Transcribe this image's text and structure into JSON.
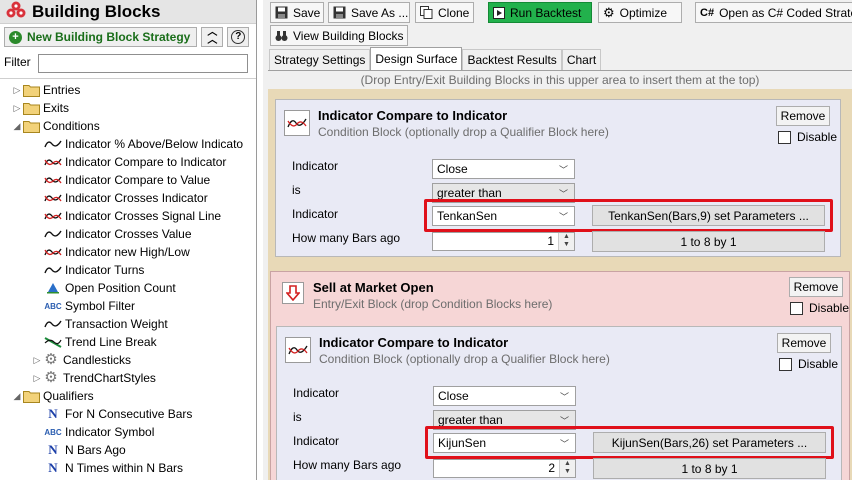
{
  "left_panel": {
    "title": "Building Blocks",
    "new_button_label": "New Building Block Strategy",
    "filter_label": "Filter",
    "filter_value": "",
    "tree": [
      {
        "label": "Entries",
        "level": 0,
        "kind": "folder",
        "expanded": false
      },
      {
        "label": "Exits",
        "level": 0,
        "kind": "folder",
        "expanded": false
      },
      {
        "label": "Conditions",
        "level": 0,
        "kind": "folder",
        "expanded": true
      },
      {
        "label": "Indicator % Above/Below Indicato",
        "level": 1,
        "kind": "wave-black"
      },
      {
        "label": "Indicator Compare to Indicator",
        "level": 1,
        "kind": "wave-red"
      },
      {
        "label": "Indicator Compare to Value",
        "level": 1,
        "kind": "wave-red"
      },
      {
        "label": "Indicator Crosses Indicator",
        "level": 1,
        "kind": "wave-red"
      },
      {
        "label": "Indicator Crosses Signal Line",
        "level": 1,
        "kind": "wave-red"
      },
      {
        "label": "Indicator Crosses Value",
        "level": 1,
        "kind": "wave-black"
      },
      {
        "label": "Indicator new High/Low",
        "level": 1,
        "kind": "wave-red"
      },
      {
        "label": "Indicator Turns",
        "level": 1,
        "kind": "wave-black"
      },
      {
        "label": "Open Position Count",
        "level": 1,
        "kind": "arrow-blue"
      },
      {
        "label": "Symbol Filter",
        "level": 1,
        "kind": "abc"
      },
      {
        "label": "Transaction Weight",
        "level": 1,
        "kind": "wave-black"
      },
      {
        "label": "Trend Line Break",
        "level": 1,
        "kind": "trend-green"
      },
      {
        "label": "Candlesticks",
        "level": 1,
        "kind": "gear",
        "expandable": true
      },
      {
        "label": "TrendChartStyles",
        "level": 1,
        "kind": "gear",
        "expandable": true
      },
      {
        "label": "Qualifiers",
        "level": 0,
        "kind": "folder",
        "expanded": true
      },
      {
        "label": "For N Consecutive Bars",
        "level": 1,
        "kind": "n-blue"
      },
      {
        "label": "Indicator Symbol",
        "level": 1,
        "kind": "abc"
      },
      {
        "label": "N Bars Ago",
        "level": 1,
        "kind": "n-blue"
      },
      {
        "label": "N Times within N Bars",
        "level": 1,
        "kind": "n-blue"
      }
    ]
  },
  "toolbar": {
    "save": "Save",
    "save_as": "Save As ...",
    "clone": "Clone",
    "run_backtest": "Run Backtest",
    "optimize": "Optimize",
    "open_csharp": "Open as C# Coded Strategy",
    "view_blocks": "View Building Blocks"
  },
  "tabs": [
    "Strategy Settings",
    "Design Surface",
    "Backtest Results",
    "Chart"
  ],
  "active_tab": "Design Surface",
  "design_surface": {
    "drop_hint": "(Drop Entry/Exit Building Blocks in this upper area to insert them at the top)",
    "condition1": {
      "title": "Indicator Compare to Indicator",
      "subtitle": "Condition Block (optionally drop a Qualifier Block here)",
      "remove": "Remove",
      "disable": "Disable",
      "label_indicator": "Indicator",
      "label_is": "is",
      "label_indicator2": "Indicator",
      "label_bars_ago": "How many Bars ago",
      "indicator1": "Close",
      "comparison": "greater than",
      "indicator2": "TenkanSen",
      "indicator2_params": "TenkanSen(Bars,9) set Parameters ...",
      "bars_ago": "1",
      "bars_range": "1 to 8 by 1"
    },
    "sell_block": {
      "title": "Sell at Market Open",
      "subtitle": "Entry/Exit Block (drop Condition Blocks here)",
      "remove": "Remove",
      "disable": "Disable"
    },
    "condition2": {
      "title": "Indicator Compare to Indicator",
      "subtitle": "Condition Block (optionally drop a Qualifier Block here)",
      "remove": "Remove",
      "disable": "Disable",
      "label_indicator": "Indicator",
      "label_is": "is",
      "label_indicator2": "Indicator",
      "label_bars_ago": "How many Bars ago",
      "indicator1": "Close",
      "comparison": "greater than",
      "indicator2": "KijunSen",
      "indicator2_params": "KijunSen(Bars,26) set Parameters ...",
      "bars_ago": "2",
      "bars_range": "1 to 8 by 1"
    }
  },
  "colors": {
    "run_backtest": "#22b14c",
    "highlight": "#e0101a",
    "condition_bg": "#e9eaf5",
    "sell_bg": "#f6d6d6"
  }
}
